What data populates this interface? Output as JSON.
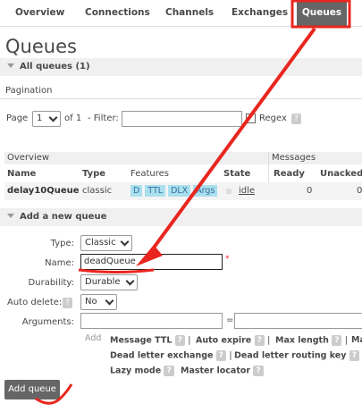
{
  "nav": {
    "tabs": [
      "Overview",
      "Connections",
      "Channels",
      "Exchanges",
      "Queues"
    ]
  },
  "page_title": "Queues",
  "all_queues_header": "All queues (1)",
  "pagination": {
    "label": "Pagination",
    "page_label": "Page",
    "page_value": "1",
    "of_label": "of 1",
    "filter_label": "- Filter:",
    "filter_value": "",
    "regex_label": "Regex",
    "help": "?"
  },
  "table": {
    "group_overview": "Overview",
    "group_messages": "Messages",
    "columns": [
      "Name",
      "Type",
      "Features",
      "State",
      "Ready",
      "Unacked"
    ],
    "rows": [
      {
        "name": "delay10Queue",
        "type": "classic",
        "features": [
          "D",
          "TTL",
          "DLX",
          "Args"
        ],
        "state": "idle",
        "ready": "0",
        "unacked": "0"
      }
    ]
  },
  "add_queue": {
    "header": "Add a new queue",
    "type_label": "Type:",
    "type_value": "Classic",
    "name_label": "Name:",
    "name_value": "deadQueue",
    "required_mark": "*",
    "durability_label": "Durability:",
    "durability_value": "Durable",
    "auto_delete_label": "Auto delete:",
    "auto_delete_help": "?",
    "auto_delete_value": "No",
    "arguments_label": "Arguments:",
    "equals": "=",
    "add_label": "Add",
    "args_line1": [
      {
        "text": "Message TTL",
        "sep": "|"
      },
      {
        "text": "Auto expire",
        "sep": "|"
      },
      {
        "text": "Max length",
        "sep": "|"
      },
      {
        "text": "Ma",
        "sep": ""
      }
    ],
    "args_line2": [
      {
        "text": "Dead letter exchange",
        "sep": "|"
      },
      {
        "text": "Dead letter routing key",
        "sep": "|"
      }
    ],
    "args_line3": [
      {
        "text": "Lazy mode",
        "sep": ""
      },
      {
        "text": "Master locator",
        "sep": ""
      }
    ],
    "submit_label": "Add queue"
  },
  "colors": {
    "annotation": "#e8261f",
    "nav_active": "#666666",
    "feature_bg": "#aae0ee"
  }
}
